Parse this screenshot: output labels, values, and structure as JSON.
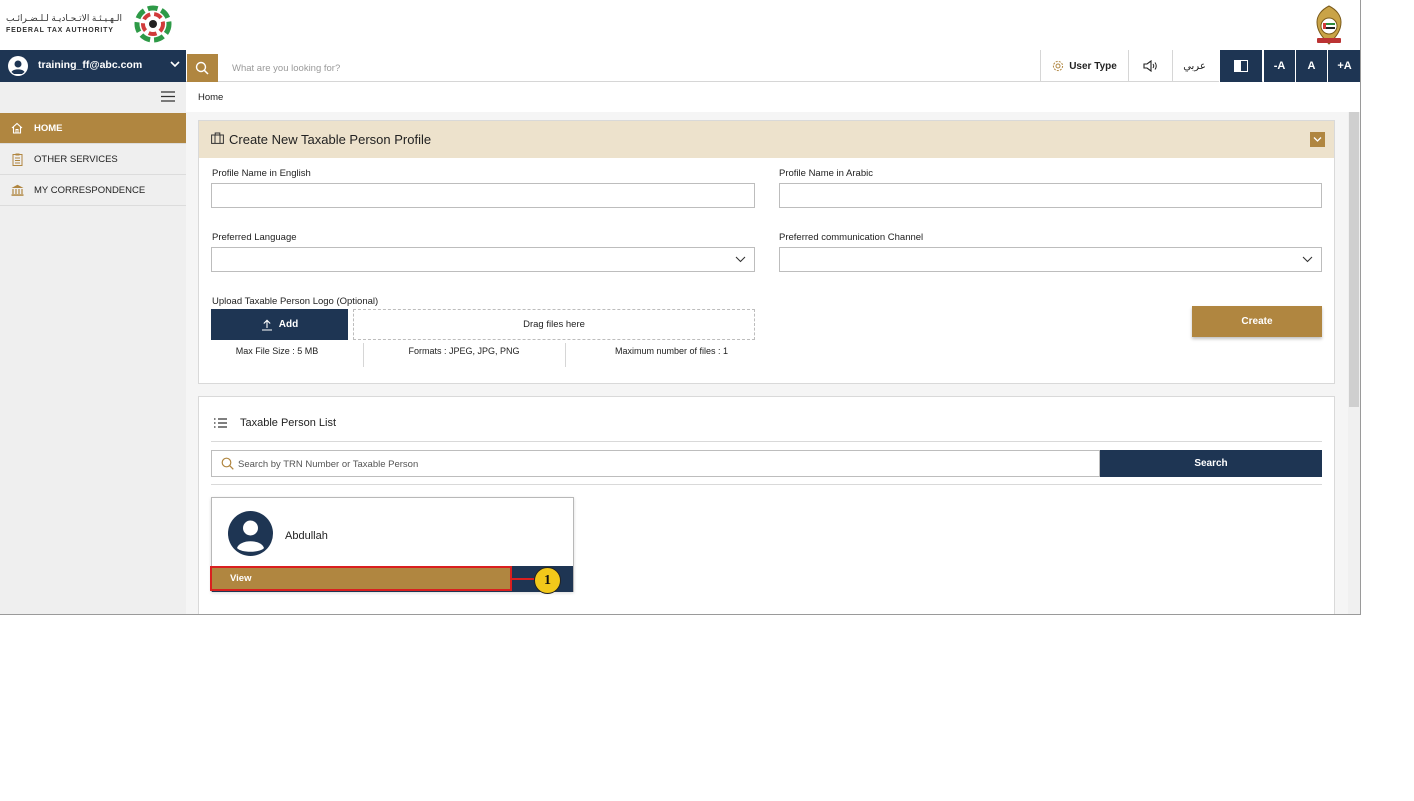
{
  "header": {
    "logo_arabic": "الـهـيـئـة الاتـحـاديـة لـلـضـرائـب",
    "logo_english": "FEDERAL TAX AUTHORITY"
  },
  "navbar": {
    "user_email": "training_ff@abc.com",
    "search_placeholder": "What are you looking for?",
    "user_type_label": "User Type",
    "arabic_label": "عربي",
    "font_decrease": "-A",
    "font_normal": "A",
    "font_increase": "+A"
  },
  "sidebar": {
    "items": [
      {
        "label": "HOME",
        "icon": "home-icon",
        "active": true
      },
      {
        "label": "OTHER SERVICES",
        "icon": "clipboard-icon",
        "active": false
      },
      {
        "label": "MY CORRESPONDENCE",
        "icon": "bank-icon",
        "active": false
      }
    ]
  },
  "breadcrumb": "Home",
  "create_profile": {
    "title": "Create New Taxable Person Profile",
    "name_en_label": "Profile Name in English",
    "name_en_value": "",
    "name_ar_label": "Profile Name in Arabic",
    "name_ar_value": "",
    "language_label": "Preferred Language",
    "language_value": "",
    "channel_label": "Preferred communication Channel",
    "channel_value": "",
    "upload_label": "Upload Taxable Person Logo (Optional)",
    "add_label": "Add",
    "drop_label": "Drag files here",
    "max_size": "Max File Size : 5 MB",
    "formats": "Formats : JPEG, JPG, PNG",
    "max_files": "Maximum number of files : 1",
    "create_label": "Create"
  },
  "taxable_list": {
    "title": "Taxable Person List",
    "search_placeholder": "Search by TRN Number or Taxable Person",
    "search_label": "Search",
    "cards": [
      {
        "name": "Abdullah",
        "view_label": "View"
      }
    ]
  },
  "annotation": {
    "number": "1"
  },
  "colors": {
    "navy": "#1e3553",
    "gold": "#b08640",
    "panel_header": "#ede2cc",
    "highlight": "#d91f1f",
    "badge": "#f2c81a"
  }
}
